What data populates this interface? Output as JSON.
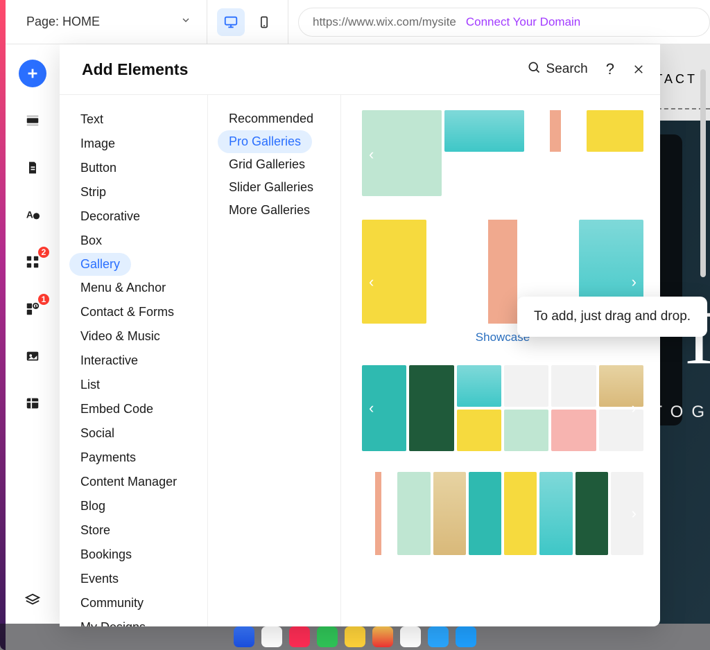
{
  "topbar": {
    "page_label": "Page: HOME",
    "url": "https://www.wix.com/mysite",
    "connect_domain": "Connect Your Domain"
  },
  "canvas": {
    "nav_item": "TACT",
    "hero_title": "T",
    "hero_sub": "OTOG"
  },
  "left_rail": {
    "badge1": "2",
    "badge2": "1"
  },
  "panel": {
    "title": "Add Elements",
    "search_label": "Search",
    "help": "?",
    "categories": [
      "Text",
      "Image",
      "Button",
      "Strip",
      "Decorative",
      "Box",
      "Gallery",
      "Menu & Anchor",
      "Contact & Forms",
      "Video & Music",
      "Interactive",
      "List",
      "Embed Code",
      "Social",
      "Payments",
      "Content Manager",
      "Blog",
      "Store",
      "Bookings",
      "Events",
      "Community",
      "My Designs"
    ],
    "active_category_index": 6,
    "subcategories": [
      "Recommended",
      "Pro Galleries",
      "Grid Galleries",
      "Slider Galleries",
      "More Galleries"
    ],
    "active_sub_index": 1,
    "showcase_label": "Showcase",
    "tooltip": "To add, just drag and drop."
  }
}
